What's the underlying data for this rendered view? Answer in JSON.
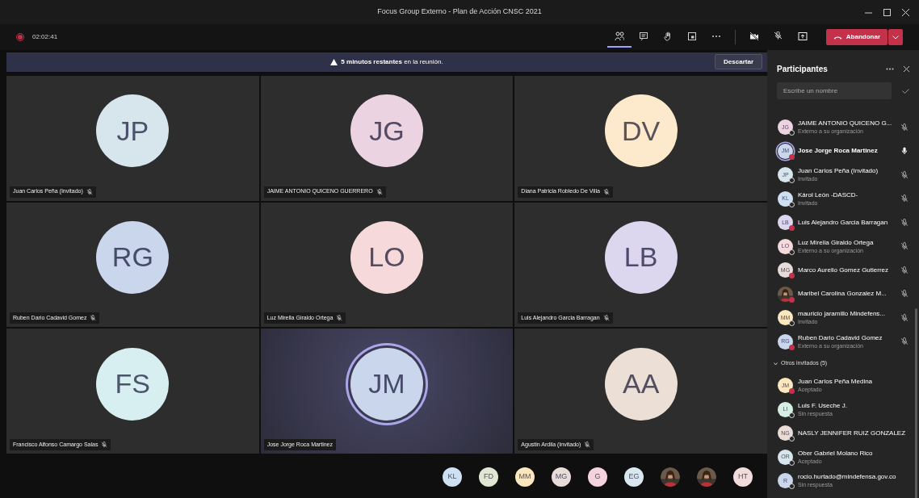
{
  "window": {
    "title": "Focus Group Externo - Plan de Acción CNSC 2021"
  },
  "call": {
    "recording": true,
    "duration": "02:02:41",
    "leave_label": "Abandonar"
  },
  "toolbar": [
    {
      "kind": "people",
      "selected": true
    },
    {
      "kind": "chat",
      "selected": false
    },
    {
      "kind": "hand",
      "selected": false
    },
    {
      "kind": "rooms",
      "selected": false
    },
    {
      "kind": "more",
      "selected": false
    },
    {
      "kind": "camera-off",
      "selected": false
    },
    {
      "kind": "mic-off",
      "selected": false
    },
    {
      "kind": "share",
      "selected": false
    }
  ],
  "banner": {
    "text": "**5 minutos restantes** en la reunión.",
    "button": "Descartar"
  },
  "tiles": [
    {
      "initials": "JP",
      "name": "Juan Carlos Peña (Invitado)",
      "muted": true,
      "speaking": false,
      "color": "#d6e6ec"
    },
    {
      "initials": "JG",
      "name": "JAIME ANTONIO QUICENO GUERRERO",
      "muted": true,
      "speaking": false,
      "color": "#ecd3e2"
    },
    {
      "initials": "DV",
      "name": "Diana Patricia Robledo De Villa",
      "muted": true,
      "speaking": false,
      "color": "#fde9cb"
    },
    {
      "initials": "RG",
      "name": "Ruben Dario Cadavid Gomez",
      "muted": true,
      "speaking": false,
      "color": "#c9d6ec"
    },
    {
      "initials": "LO",
      "name": "Luz Mirella Giraldo Ortega",
      "muted": true,
      "speaking": false,
      "color": "#f6d9da"
    },
    {
      "initials": "LB",
      "name": "Luis Alejandro Garcia Barragan",
      "muted": true,
      "speaking": false,
      "color": "#dcd6ef"
    },
    {
      "initials": "FS",
      "name": "Francisco Alfonso Camargo Salas",
      "muted": true,
      "speaking": false,
      "color": "#d8eff1"
    },
    {
      "initials": "JM",
      "name": "Jose Jorge Roca Martinez",
      "muted": false,
      "speaking": true,
      "color": "#cad6ec"
    },
    {
      "initials": "AA",
      "name": "Agustin Ardila (Invitado)",
      "muted": true,
      "speaking": false,
      "color": "#ecdfd5"
    }
  ],
  "strip": [
    {
      "kind": "initials",
      "initials": "KL",
      "color": "#cfe0f2"
    },
    {
      "kind": "initials",
      "initials": "FD",
      "color": "#dfe6d3"
    },
    {
      "kind": "initials",
      "initials": "MM",
      "color": "#fbe7bd"
    },
    {
      "kind": "initials",
      "initials": "MG",
      "color": "#e8dcd9"
    },
    {
      "kind": "initials",
      "initials": "G",
      "color": "#f4d3de"
    },
    {
      "kind": "initials",
      "initials": "EG",
      "color": "#d8e8ee"
    },
    {
      "kind": "picture"
    },
    {
      "kind": "picture"
    },
    {
      "kind": "initials",
      "initials": "HT",
      "color": "#f1dcdc"
    }
  ],
  "panel": {
    "title": "Participantes",
    "search_placeholder": "Escribe un nombre",
    "participants": [
      {
        "kind": "initials",
        "initials": "JG",
        "color": "#ecd3e2",
        "name": "JAIME ANTONIO QUICENO G...",
        "subtitle": "Externo a su organización",
        "busy": false,
        "muted": true,
        "speaking": false
      },
      {
        "kind": "initials",
        "initials": "JM",
        "color": "#cad6ec",
        "name": "Jose Jorge Roca Martinez",
        "busy": true,
        "muted": false,
        "speaking": true
      },
      {
        "kind": "initials",
        "initials": "JP",
        "color": "#d6e6ec",
        "name": "Juan Carlos Peña (Invitado)",
        "subtitle": "Invitado",
        "busy": false,
        "muted": true,
        "speaking": false
      },
      {
        "kind": "initials",
        "initials": "KL",
        "color": "#cfe0f2",
        "name": "Károl León -DASCD-",
        "subtitle": "Invitado",
        "busy": false,
        "muted": true,
        "speaking": false
      },
      {
        "kind": "initials",
        "initials": "LB",
        "color": "#dcd6ef",
        "name": "Luis Alejandro Garcia Barragan",
        "busy": true,
        "muted": true,
        "speaking": false
      },
      {
        "kind": "initials",
        "initials": "LO",
        "color": "#f6d9da",
        "name": "Luz Mirella Giraldo Ortega",
        "subtitle": "Externo a su organización",
        "busy": false,
        "muted": true,
        "speaking": false
      },
      {
        "kind": "initials",
        "initials": "MG",
        "color": "#e8dcd9",
        "name": "Marco Aurelio Gomez Gutierrez",
        "busy": true,
        "muted": true,
        "speaking": false
      },
      {
        "kind": "picture",
        "name": "Maribel Carolina Gonzalez M...",
        "busy": true,
        "muted": true,
        "speaking": false
      },
      {
        "kind": "initials",
        "initials": "MM",
        "color": "#fbe7bd",
        "name": "mauricio jaramillo Mindefens...",
        "subtitle": "Invitado",
        "busy": false,
        "muted": true,
        "speaking": false
      },
      {
        "kind": "initials",
        "initials": "RG",
        "color": "#c9d6ec",
        "name": "Ruben Dario Cadavid Gomez",
        "subtitle": "Externo a su organización",
        "busy": true,
        "muted": true,
        "speaking": false
      }
    ],
    "others": {
      "label": "Otros invitados (5)",
      "expanded": true,
      "people": [
        {
          "initials": "JM",
          "color": "#fbe7bd",
          "name": "Juan Carlos Peña Medina",
          "subtitle": "Aceptado",
          "busy": true
        },
        {
          "initials": "LI",
          "color": "#d4efe2",
          "name": "Luis F. Useche J.",
          "subtitle": "Sin respuesta",
          "busy": false
        },
        {
          "initials": "NG",
          "color": "#ecdcd6",
          "name": "NASLY JENNIFER RUIZ GONZALEZ",
          "busy": false
        },
        {
          "initials": "OR",
          "color": "#d6e6ec",
          "name": "Ober Gabriel Molano Rico",
          "subtitle": "Aceptado",
          "busy": false
        },
        {
          "initials": "R",
          "color": "#cad6ec",
          "name": "rocio.hurtado@mindefensa.gov.co",
          "subtitle": "Sin respuesta",
          "busy": false
        }
      ]
    }
  }
}
